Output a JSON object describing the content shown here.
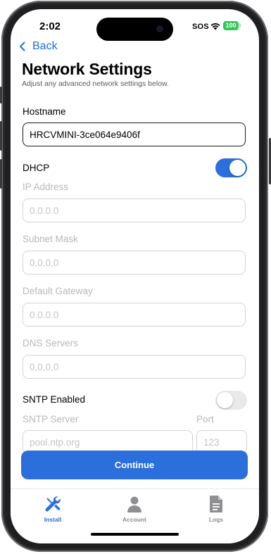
{
  "status_bar": {
    "time": "2:02",
    "sos": "SOS",
    "battery": "100"
  },
  "nav": {
    "back_label": "Back"
  },
  "header": {
    "title": "Network Settings",
    "subtitle": "Adjust any advanced network settings below."
  },
  "form": {
    "hostname": {
      "label": "Hostname",
      "value": "HRCVMINI-3ce064e9406f"
    },
    "dhcp": {
      "label": "DHCP",
      "enabled": true
    },
    "ip_address": {
      "label": "IP Address",
      "placeholder": "0.0.0.0"
    },
    "subnet_mask": {
      "label": "Subnet Mask",
      "placeholder": "0.0.0.0"
    },
    "default_gateway": {
      "label": "Default Gateway",
      "placeholder": "0.0.0.0"
    },
    "dns_servers": {
      "label": "DNS Servers",
      "placeholder": "0.0.0.0"
    },
    "sntp_enabled": {
      "label": "SNTP Enabled",
      "enabled": false
    },
    "sntp_server": {
      "label": "SNTP Server",
      "placeholder": "pool.ntp.org"
    },
    "port": {
      "label": "Port",
      "placeholder": "123"
    }
  },
  "actions": {
    "continue_label": "Continue"
  },
  "tabs": [
    {
      "label": "Install",
      "icon": "wrench-icon",
      "active": true
    },
    {
      "label": "Account",
      "icon": "person-icon",
      "active": false
    },
    {
      "label": "Logs",
      "icon": "document-icon",
      "active": false
    }
  ],
  "colors": {
    "accent": "#2a6fdc",
    "disabled_text": "#b8b8b8",
    "battery": "#34c759"
  }
}
